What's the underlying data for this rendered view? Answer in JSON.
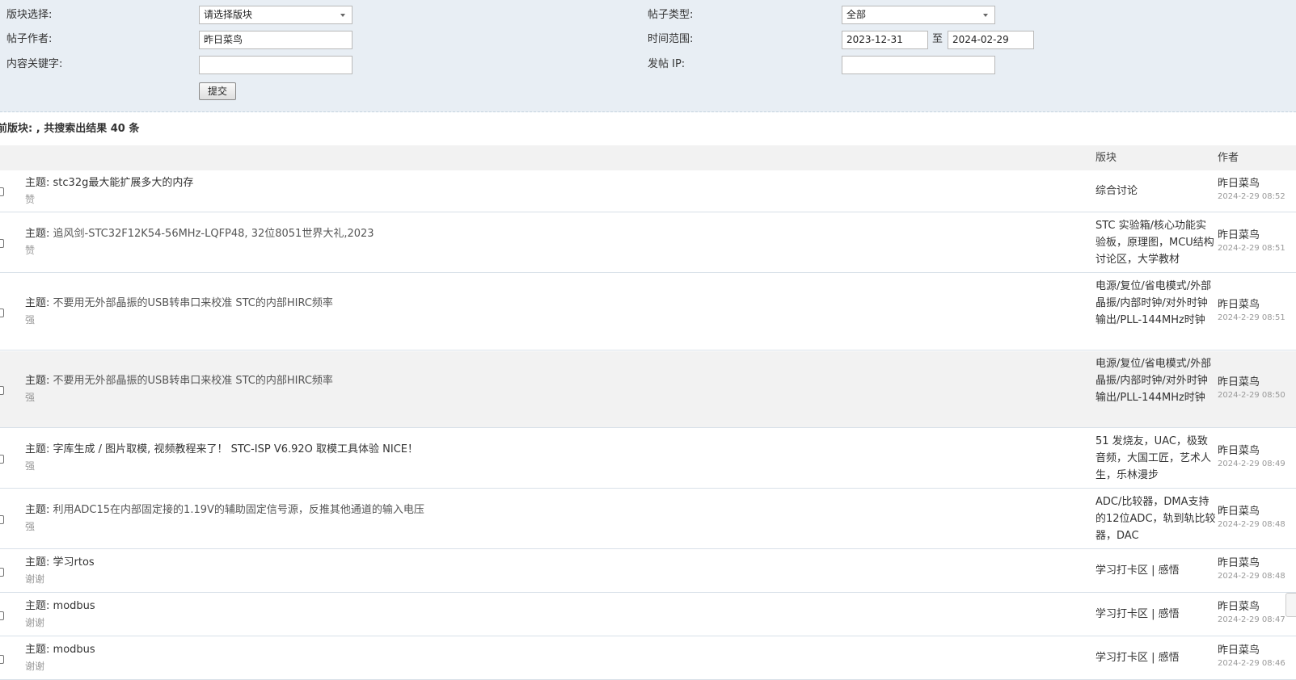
{
  "search": {
    "board_label": "版块选择:",
    "board_value": "请选择版块",
    "type_label": "帖子类型:",
    "type_value": "全部",
    "author_label": "帖子作者:",
    "author_value": "昨日菜鸟",
    "time_label": "时间范围:",
    "time_from": "2023-12-31",
    "time_to_sep": "至",
    "time_to": "2024-02-29",
    "keyword_label": "内容关键字:",
    "keyword_value": "",
    "ip_label": "发帖 IP:",
    "ip_value": "",
    "submit_label": "提交"
  },
  "summary": "前版块: , 共搜索出结果 40 条",
  "table": {
    "col_forum": "版块",
    "col_author": "作者",
    "rows": [
      {
        "prefix": "主题:",
        "title": "stc32g最大能扩展多大的内存",
        "tag": "赞",
        "forum": "综合讨论",
        "author": "昨日菜鸟",
        "time": "2024-2-29 08:52"
      },
      {
        "prefix": "主题:",
        "title": "追风剑-STC32F12K54-56MHz-LQFP48, 32位8051世界大礼,2023",
        "tag": "赞",
        "forum": "STC 实验箱/核心功能实验板，原理图，MCU结构讨论区，大学教材",
        "author": "昨日菜鸟",
        "time": "2024-2-29 08:51"
      },
      {
        "prefix": "主题:",
        "title": "不要用无外部晶振的USB转串口来校准 STC的内部HIRC频率",
        "tag": "强",
        "forum": "电源/复位/省电模式/外部晶振/内部时钟/对外时钟输出/PLL-144MHz时钟",
        "author": "昨日菜鸟",
        "time": "2024-2-29 08:51"
      },
      {
        "prefix": "主题:",
        "title": "不要用无外部晶振的USB转串口来校准 STC的内部HIRC频率",
        "tag": "强",
        "forum": "电源/复位/省电模式/外部晶振/内部时钟/对外时钟输出/PLL-144MHz时钟",
        "author": "昨日菜鸟",
        "time": "2024-2-29 08:50"
      },
      {
        "prefix": "主题:",
        "title": "字库生成 / 图片取模, 视频教程来了！ STC-ISP V6.92O 取模工具体验 NICE！",
        "tag": "强",
        "forum": "51 发烧友，UAC，极致音频，大国工匠，艺术人生，乐林漫步",
        "author": "昨日菜鸟",
        "time": "2024-2-29 08:49"
      },
      {
        "prefix": "主题:",
        "title": "利用ADC15在内部固定接的1.19V的辅助固定信号源，反推其他通道的输入电压",
        "tag": "强",
        "forum": "ADC/比较器，DMA支持的12位ADC，轨到轨比较器，DAC",
        "author": "昨日菜鸟",
        "time": "2024-2-29 08:48"
      },
      {
        "prefix": "主题:",
        "title": "学习rtos",
        "tag": "谢谢",
        "forum": "学习打卡区 | 感悟",
        "author": "昨日菜鸟",
        "time": "2024-2-29 08:48"
      },
      {
        "prefix": "主题:",
        "title": "modbus",
        "tag": "谢谢",
        "forum": "学习打卡区 | 感悟",
        "author": "昨日菜鸟",
        "time": "2024-2-29 08:47"
      },
      {
        "prefix": "主题:",
        "title": "modbus",
        "tag": "谢谢",
        "forum": "学习打卡区 | 感悟",
        "author": "昨日菜鸟",
        "time": "2024-2-29 08:46"
      }
    ]
  }
}
